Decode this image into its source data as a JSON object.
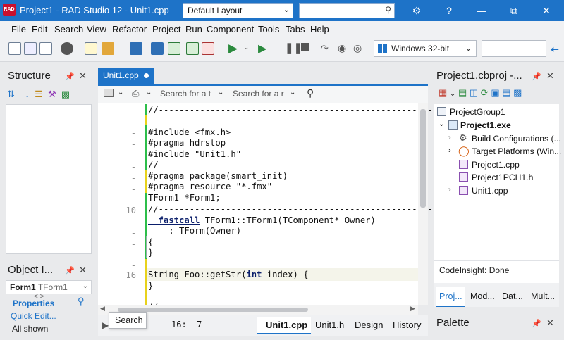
{
  "window": {
    "title": "Project1 - RAD Studio 12 - Unit1.cpp",
    "logo": "RAD",
    "layout": "Default Layout"
  },
  "menu": [
    "File",
    "Edit",
    "Search",
    "View",
    "Refactor",
    "Project",
    "Run",
    "Component",
    "Tools",
    "Tabs",
    "Help"
  ],
  "toolbar": {
    "platform": "Windows 32-bit"
  },
  "structure": {
    "title": "Structure"
  },
  "object_inspector": {
    "title": "Object I...",
    "selected_name": "Form1",
    "selected_type": "TForm1",
    "properties_tab": "Properties",
    "quick_edit": "Quick Edit...",
    "filter": "All shown"
  },
  "editor": {
    "tab": "Unit1.cpp",
    "search1": "Search for a t",
    "search2": "Search for a r",
    "line_numbers": {
      "l10": "10",
      "l16": "16"
    },
    "code": {
      "c1": "//----------------------------------------------------------",
      "c3": "#include <fmx.h>",
      "c4": "#pragma hdrstop",
      "c5": "#include \"Unit1.h\"",
      "c6": "//----------------------------------------------------------",
      "c7": "#pragma package(smart_init)",
      "c8": "#pragma resource \"*.fmx\"",
      "c9": "TForm1 *Form1;",
      "c10": "//----------------------------------------------------------",
      "c11a": "__fastcall",
      "c11b": " TForm1::TForm1(TComponent* Owner)",
      "c12": "    : TForm(Owner)",
      "c13": "{",
      "c14": "}",
      "c16a": "String Foo::getStr(",
      "c16b": "int",
      "c16c": " index) {",
      "c17": "}",
      "c19": "//"
    },
    "cursor_pos": "16:  7",
    "bottom_tabs": [
      "Unit1.cpp",
      "Unit1.h",
      "Design",
      "History"
    ],
    "tooltip": "Search"
  },
  "project": {
    "title": "Project1.cbproj -...",
    "tree": [
      "ProjectGroup1",
      "Project1.exe",
      "Build Configurations (...",
      "Target Platforms (Win...",
      "Project1.cpp",
      "Project1PCH1.h",
      "Unit1.cpp"
    ],
    "codeinsight": "CodeInsight: Done",
    "tabs": [
      "Proj...",
      "Mod...",
      "Dat...",
      "Mult..."
    ]
  },
  "palette": {
    "title": "Palette"
  },
  "colors": {
    "accent": "#1e73c8",
    "change_green": "#2dbe4a",
    "change_yellow": "#e8d21c"
  }
}
